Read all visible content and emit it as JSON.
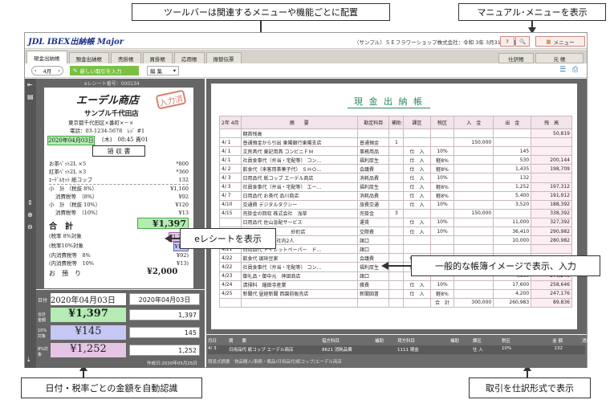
{
  "callouts": {
    "toolbar": "ツールバーは関連するメニューや機能ごとに配置",
    "manual": "マニュアル･メニューを表示",
    "ereceipt": "eレシートを表示",
    "ledger": "一般的な帳簿イメージで表示、入力",
    "auto": "日付・税率ごとの金額を自動認識",
    "entry": "取引を仕訳形式で表示"
  },
  "app": {
    "logo": "JDL IBEX出納帳 Major",
    "company": "（サンプル）ＳＥフラワーショップ株式会社：令和 3年 3月31日決算",
    "menu_label": "メニュー",
    "tabs": [
      "現金出納帳",
      "預金出納帳",
      "売掛帳",
      "買掛帳",
      "応用帳",
      "振替伝票"
    ],
    "right_tabs": [
      "仕訳帳",
      "元 帳"
    ],
    "month": "4月",
    "new_entry": "新しい取引を入力",
    "edit": "編 集",
    "ereceipt_no": "eレシート番号：000134"
  },
  "receipt": {
    "store": "エーデル商店",
    "stamp": "入力済",
    "branch": "サンプル千代田店",
    "address": "東京都千代田区×番町×－×",
    "phone": "電話：03-1234-5678　ﾚｼﾞ #1",
    "date": "2020年04月03日",
    "dow_time": "(木)　08:45 責01",
    "title": "領 収 書",
    "items": [
      {
        "name": "お茶ﾍﾟｯﾄ2L ×5",
        "amt": "*800"
      },
      {
        "name": "紅茶ﾍﾟｯﾄ2L ×3",
        "amt": "*360"
      },
      {
        "name": "ｴｰﾃﾞﾙｾｯﾄ 紙コップ",
        "amt": "132"
      }
    ],
    "sub1": {
      "label": "小　計 （税抜 8%）",
      "amt": "¥1,160"
    },
    "tax1": {
      "label": "消費税等　（8%）",
      "amt": "¥92"
    },
    "sub2": {
      "label": "小　計 （税抜 10%）",
      "amt": "¥120"
    },
    "tax2": {
      "label": "消費税等　（10%）",
      "amt": "¥13"
    },
    "total_label": "合　計",
    "total": "¥1,397",
    "t8": {
      "label": "(税率 8%対象",
      "amt": "¥1,252"
    },
    "t10": {
      "label": "(税率10%対象",
      "amt": "¥145"
    },
    "in8": {
      "label": "(内消費税等　8%",
      "amt": "¥92)"
    },
    "in10": {
      "label": "(内消費税等　10%",
      "amt": "¥13)"
    },
    "paid_label": "お　預　り",
    "paid": "¥2,000"
  },
  "amounts": {
    "date_label": "日付",
    "date_read": "2020年04月03日",
    "date_val": "2020年04月03日",
    "total_label": "合計金額",
    "total_read": "¥1,397",
    "total_val": "1,397",
    "r10_label": "10%対象",
    "r10_read": "¥145",
    "r10_val": "145",
    "r8_label": "8%対象",
    "r8_read": "¥1,252",
    "r8_val": "1,252",
    "created": "作成日:2020年05月25日"
  },
  "ledger": {
    "title": "現 金 出 納 帳",
    "headers": [
      "2年\n4月",
      "摘　　要",
      "勘定科目",
      "補助",
      "課区",
      "税区",
      "入　金",
      "出　金",
      "残　高"
    ],
    "rows": [
      [
        "",
        "",
        "期首残高",
        "",
        "",
        "",
        "",
        "",
        "",
        "50,819"
      ],
      [
        "4/ 1",
        "普通預金から引出 東陽銀行東陽支店",
        "普通預金",
        "1",
        "",
        "",
        "150,000",
        "",
        ""
      ],
      [
        "4/ 1",
        "文房具代 東記用具 コンビニＦＭ",
        "事務用品",
        "",
        "仕　入",
        "10%",
        "",
        "145",
        ""
      ],
      [
        "4/ 1",
        "社員食事代（弁当・宅配等） コン…",
        "福利厚生",
        "",
        "仕　入",
        "軽8%",
        "",
        "530",
        "200,144"
      ],
      [
        "4/ 2",
        "飲食代（来客用茶菓子代） ＳＨＯ…",
        "会議費",
        "",
        "仕　入",
        "軽8%",
        "",
        "1,435",
        "198,709"
      ],
      [
        "4/ 3",
        "日用品代 紙コップ エーデル商店",
        "消耗品費",
        "",
        "仕　入",
        "10%",
        "",
        "132",
        ""
      ],
      [
        "4/ 3",
        "社員食事代（弁当・宅配等） エー…",
        "福利厚生",
        "",
        "仕　入",
        "軽8%",
        "",
        "1,252",
        "197,312"
      ],
      [
        "4/ 7",
        "日用品代 お茶代 品川商店",
        "消耗品費",
        "",
        "仕　入",
        "軽8%",
        "",
        "5,400",
        "191,912"
      ],
      [
        "4/10",
        "交通費 デジタルタクシー",
        "旅費交通",
        "",
        "仕　入",
        "10%",
        "",
        "3,520",
        "188,392"
      ],
      [
        "4/15",
        "売掛金の回収 株式会社　浅草",
        "売掛金",
        "3",
        "",
        "",
        "150,000",
        "",
        "338,392"
      ],
      [
        "",
        "日用品代 佐山急配サービス",
        "運賃",
        "",
        "仕　入",
        "10%",
        "",
        "11,000",
        "327,392"
      ],
      [
        "",
        "　　　　　　　　　　紗町店",
        "交際費",
        "",
        "仕　入",
        "10%",
        "",
        "36,410",
        "290,982"
      ],
      [
        "",
        "　　　　　　　社内2人",
        "諸口",
        "",
        "",
        "",
        "",
        "10,000",
        "280,982"
      ],
      [
        "4/21",
        "日用品代 トイレットペーパー　ド…",
        "諸口",
        "",
        "",
        "",
        "",
        "",
        "",
        ""
      ],
      [
        "4/22",
        "飲食代 珈琲豆家",
        "会議費",
        "",
        "仕　入",
        "軽8%",
        "",
        "",
        "280,982"
      ],
      [
        "4/22",
        "社員食事代（弁当・宅配等） コン…",
        "福利厚生",
        "",
        "仕　入",
        "軽8%",
        "",
        "",
        "280,982"
      ],
      [
        "4/23",
        "御礼品・御中元　神田商店",
        "諸口",
        "",
        "",
        "",
        "",
        "4,360",
        "276,246"
      ],
      [
        "4/24",
        "清掃料　鐘田寺産業",
        "雑費",
        "",
        "仕　入",
        "10%",
        "",
        "17,600",
        "258,646"
      ],
      [
        "4/25",
        "新聞代 昼経新聞 西園前販売店",
        "新聞図書",
        "",
        "仕　入",
        "軽8%",
        "",
        "4,200",
        "247,176"
      ]
    ],
    "total_label": "合　計",
    "total_in": "300,000",
    "total_out": "260,983",
    "total_bal": "89,836"
  },
  "entry": {
    "headers": [
      "月日",
      "摘　　要",
      "借方科目",
      "補助",
      "貸方科目",
      "補助",
      "課区",
      "税区",
      "金 額",
      "消費税等"
    ],
    "row": [
      "4/ 3",
      "日用品代 紙コップ エーデル商店",
      "8621 消耗品費",
      "",
      "1111 現金",
      "",
      "仕 入",
      "10%",
      "132",
      "12"
    ],
    "footer": "簡易式摘要　物品購入/事務・備品/日用品代/紙コップ/エーデル商店"
  },
  "colors": {
    "receipt_total_bg": "#b4ecb4",
    "r10_bg": "#c7c7f5",
    "r8_bg": "#e5c4e5",
    "stamp": "#d88070",
    "ledger_title": "#2a8a5a"
  }
}
